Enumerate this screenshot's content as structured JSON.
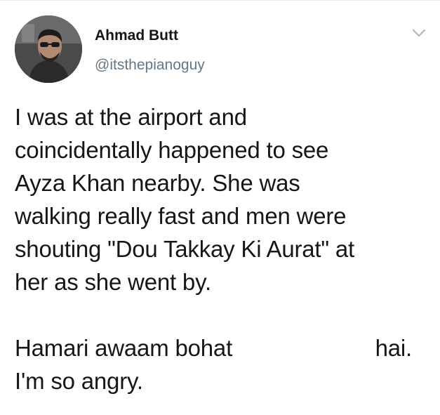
{
  "author": {
    "name": "Ahmad Butt",
    "handle": "@itsthepianoguy",
    "avatar_icon": "profile-photo"
  },
  "menu": {
    "icon": "chevron-down-icon"
  },
  "tweet": {
    "paragraph1": "I was at the airport and\ncoincidentally happened to see\nAyza Khan nearby. She was\nwalking really fast and men were\nshouting \"Dou Takkay Ki Aurat\" at\nher as she went by.",
    "paragraph2_left": "Hamari awaam bohat",
    "paragraph2_right": "hai.",
    "paragraph3": "I'm so angry."
  },
  "colors": {
    "text": "#14171a",
    "secondary": "#657786",
    "border": "#e6ecf0"
  }
}
